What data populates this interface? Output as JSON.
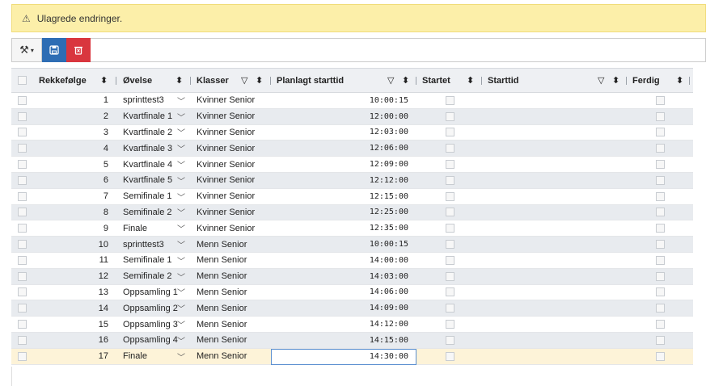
{
  "banner": {
    "icon": "warning-icon",
    "message": "Ulagrede endringer."
  },
  "toolbar": {
    "tools_icon": "tools-icon",
    "save_icon": "save-icon",
    "delete_icon": "delete-icon"
  },
  "columns": {
    "rekkefolge": "Rekkefølge",
    "ovelse": "Øvelse",
    "klasser": "Klasser",
    "planlagt": "Planlagt starttid",
    "startet": "Startet",
    "starttid": "Starttid",
    "ferdig": "Ferdig"
  },
  "rows": [
    {
      "nr": "1",
      "ovelse": "sprinttest3",
      "klasse": "Kvinner Senior",
      "tid": "10:00:15"
    },
    {
      "nr": "2",
      "ovelse": "Kvartfinale 1",
      "klasse": "Kvinner Senior",
      "tid": "12:00:00"
    },
    {
      "nr": "3",
      "ovelse": "Kvartfinale 2",
      "klasse": "Kvinner Senior",
      "tid": "12:03:00"
    },
    {
      "nr": "4",
      "ovelse": "Kvartfinale 3",
      "klasse": "Kvinner Senior",
      "tid": "12:06:00"
    },
    {
      "nr": "5",
      "ovelse": "Kvartfinale 4",
      "klasse": "Kvinner Senior",
      "tid": "12:09:00"
    },
    {
      "nr": "6",
      "ovelse": "Kvartfinale 5",
      "klasse": "Kvinner Senior",
      "tid": "12:12:00"
    },
    {
      "nr": "7",
      "ovelse": "Semifinale 1",
      "klasse": "Kvinner Senior",
      "tid": "12:15:00"
    },
    {
      "nr": "8",
      "ovelse": "Semifinale 2",
      "klasse": "Kvinner Senior",
      "tid": "12:25:00"
    },
    {
      "nr": "9",
      "ovelse": "Finale",
      "klasse": "Kvinner Senior",
      "tid": "12:35:00"
    },
    {
      "nr": "10",
      "ovelse": "sprinttest3",
      "klasse": "Menn Senior",
      "tid": "10:00:15"
    },
    {
      "nr": "11",
      "ovelse": "Semifinale 1",
      "klasse": "Menn Senior",
      "tid": "14:00:00"
    },
    {
      "nr": "12",
      "ovelse": "Semifinale 2",
      "klasse": "Menn Senior",
      "tid": "14:03:00"
    },
    {
      "nr": "13",
      "ovelse": "Oppsamling 1",
      "klasse": "Menn Senior",
      "tid": "14:06:00"
    },
    {
      "nr": "14",
      "ovelse": "Oppsamling 2",
      "klasse": "Menn Senior",
      "tid": "14:09:00"
    },
    {
      "nr": "15",
      "ovelse": "Oppsamling 3",
      "klasse": "Menn Senior",
      "tid": "14:12:00"
    },
    {
      "nr": "16",
      "ovelse": "Oppsamling 4",
      "klasse": "Menn Senior",
      "tid": "14:15:00"
    },
    {
      "nr": "17",
      "ovelse": "Finale",
      "klasse": "Menn Senior",
      "tid": "14:30:00",
      "selected": true
    }
  ],
  "colors": {
    "banner": "#fcefa9",
    "save": "#2e6db4",
    "delete": "#d9363e",
    "selected_row": "#fdf3d8"
  }
}
